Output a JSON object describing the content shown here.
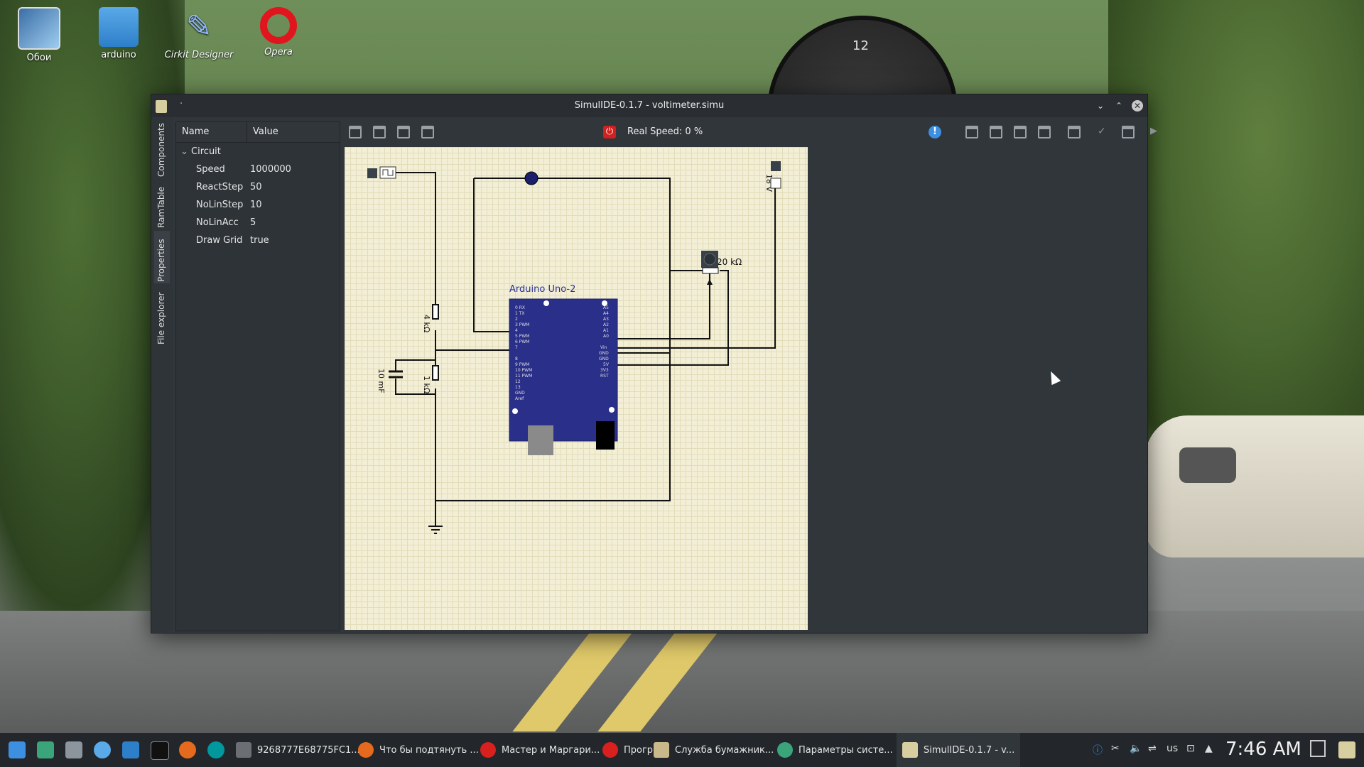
{
  "desktop": {
    "icons": [
      {
        "label": "Обои"
      },
      {
        "label": "arduino"
      },
      {
        "label": "Cirkit Designer"
      },
      {
        "label": "Opera"
      }
    ],
    "gauge_number": "12"
  },
  "window": {
    "title": "SimulIDE-0.1.7 - voltimeter.simu",
    "title_dot": "·",
    "controls": {
      "minimize": "⌄",
      "maximize": "⌃",
      "close": "✕"
    }
  },
  "side_tabs": [
    "Components",
    "RamTable",
    "Properties",
    "File explorer"
  ],
  "properties": {
    "headers": {
      "name": "Name",
      "value": "Value"
    },
    "root": "Circuit",
    "rows": [
      {
        "name": "Speed",
        "value": "1000000"
      },
      {
        "name": "ReactStep",
        "value": "50"
      },
      {
        "name": "NoLinStep",
        "value": "10"
      },
      {
        "name": "NoLinAcc",
        "value": "5"
      },
      {
        "name": "Draw Grid",
        "value": "true"
      }
    ]
  },
  "toolbar": {
    "real_speed": "Real Speed: 0 %",
    "power_glyph": "⏻",
    "info_glyph": "!"
  },
  "circuit": {
    "board_label": "Arduino Uno-2",
    "labels": {
      "r4k": "4 kΩ",
      "r1k": "1 kΩ",
      "cap": "10 mF",
      "pot": "20 kΩ",
      "battery": "18 V"
    },
    "left_pins": [
      "0  RX",
      "1  TX",
      "2",
      "3  PWM",
      "4",
      "5  PWM",
      "6  PWM",
      "7",
      "8",
      "9  PWM",
      "10 PWM",
      "11 PWM",
      "12",
      "13",
      "GND",
      "Aref"
    ],
    "right_pins": [
      "A5",
      "A4",
      "A3",
      "A2",
      "A1",
      "A0",
      "Vin",
      "GND",
      "GND",
      "5V",
      "3V3",
      "RST"
    ]
  },
  "taskbar": {
    "items": [
      {
        "label": "9268777E68775FC1...",
        "color": "#6b6f73"
      },
      {
        "label": "Что бы подтянуть ...",
        "color": "#e66a1e"
      },
      {
        "label": "Мастер и Маргари...",
        "color": "#d8201f"
      },
      {
        "label": "Прогр...",
        "color": "#d8201f"
      },
      {
        "label": "Служба бумажник...",
        "color": "#c9b98a"
      },
      {
        "label": "Параметры систе...",
        "color": "#3aa57a"
      },
      {
        "label": "SimulIDE-0.1.7 - v...",
        "color": "#d8cfa0"
      }
    ],
    "layout": "us",
    "clock": "7:46 AM"
  }
}
